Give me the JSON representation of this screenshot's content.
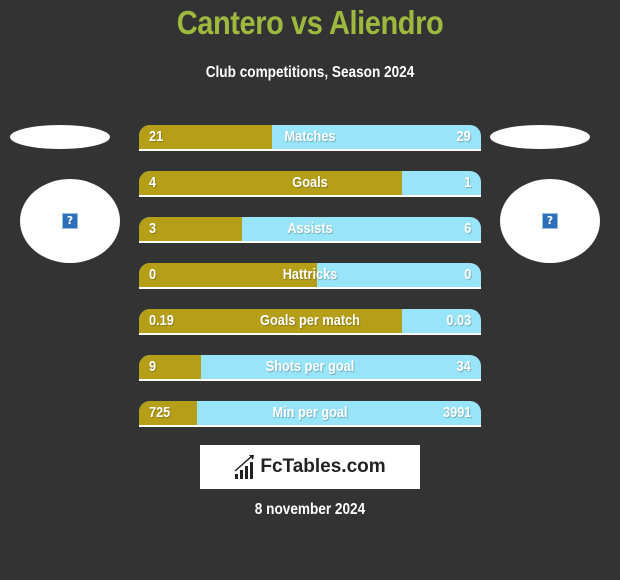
{
  "header": {
    "title": "Cantero vs Aliendro",
    "subtitle": "Club competitions, Season 2024"
  },
  "players": {
    "left": {
      "name": "Cantero",
      "image_icon": "missing-image-icon",
      "placeholder_glyph": "?"
    },
    "right": {
      "name": "Aliendro",
      "image_icon": "missing-image-icon",
      "placeholder_glyph": "?"
    }
  },
  "colors": {
    "background": "#333333",
    "title": "#9dba3e",
    "left_bar": "#b59f19",
    "right_bar": "#98e4f8",
    "text": "#ffffff"
  },
  "stats": [
    {
      "label": "Matches",
      "left": "21",
      "right": "29",
      "left_share": 0.39
    },
    {
      "label": "Goals",
      "left": "4",
      "right": "1",
      "left_share": 0.77
    },
    {
      "label": "Assists",
      "left": "3",
      "right": "6",
      "left_share": 0.3
    },
    {
      "label": "Hattricks",
      "left": "0",
      "right": "0",
      "left_share": 0.52
    },
    {
      "label": "Goals per match",
      "left": "0.19",
      "right": "0.03",
      "left_share": 0.77
    },
    {
      "label": "Shots per goal",
      "left": "9",
      "right": "34",
      "left_share": 0.18
    },
    {
      "label": "Min per goal",
      "left": "725",
      "right": "3991",
      "left_share": 0.17
    }
  ],
  "footer": {
    "logo_text": "FcTables.com",
    "logo_icon": "bar-chart-icon",
    "date": "8 november 2024"
  }
}
